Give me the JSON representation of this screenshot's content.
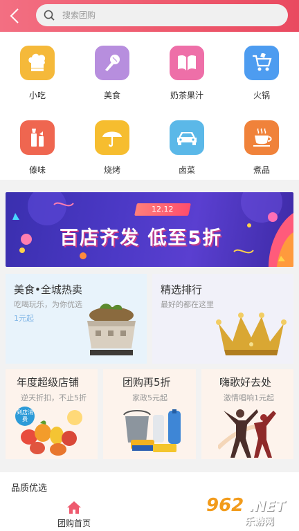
{
  "header": {
    "search_placeholder": "搜索团购"
  },
  "categories": [
    {
      "label": "小吃",
      "icon": "chef-hat-icon",
      "color": "#f5b93a"
    },
    {
      "label": "美食",
      "icon": "microphone-icon",
      "color": "#b78ede"
    },
    {
      "label": "奶茶果汁",
      "icon": "book-icon",
      "color": "#ee6fa8"
    },
    {
      "label": "火锅",
      "icon": "shopping-cart-icon",
      "color": "#4d9cf0"
    },
    {
      "label": "傣味",
      "icon": "cosmetics-icon",
      "color": "#ef6650"
    },
    {
      "label": "烧烤",
      "icon": "umbrella-icon",
      "color": "#f6bd2f"
    },
    {
      "label": "卤菜",
      "icon": "car-icon",
      "color": "#5bb8e8"
    },
    {
      "label": "煮品",
      "icon": "coffee-cup-icon",
      "color": "#f0823a"
    }
  ],
  "banner": {
    "tag": "12.12",
    "headline": "百店齐发 低至5折"
  },
  "promos": {
    "food": {
      "title": "美食•全城热卖",
      "subtitle": "吃喝玩乐，为你优选",
      "price": "1元起"
    },
    "ranking": {
      "title": "精选排行",
      "subtitle": "最好的都在这里"
    },
    "annual": {
      "title": "年度超级店铺",
      "subtitle": "逆天折扣，不止5折",
      "badge": "到店消费"
    },
    "discount": {
      "title": "团购再5折",
      "subtitle": "家政5元起"
    },
    "ktv": {
      "title": "嗨歌好去处",
      "subtitle": "激情唱响1元起"
    }
  },
  "section": {
    "title": "品质优选"
  },
  "nav": {
    "home_label": "团购首页"
  },
  "watermark": {
    "number": "962",
    "net": ".NET",
    "site": "乐游网"
  },
  "colors": {
    "header_start": "#f36f82",
    "header_end": "#e94a60",
    "accent": "#ee5a6e",
    "price_blue": "#7fb5e6"
  }
}
